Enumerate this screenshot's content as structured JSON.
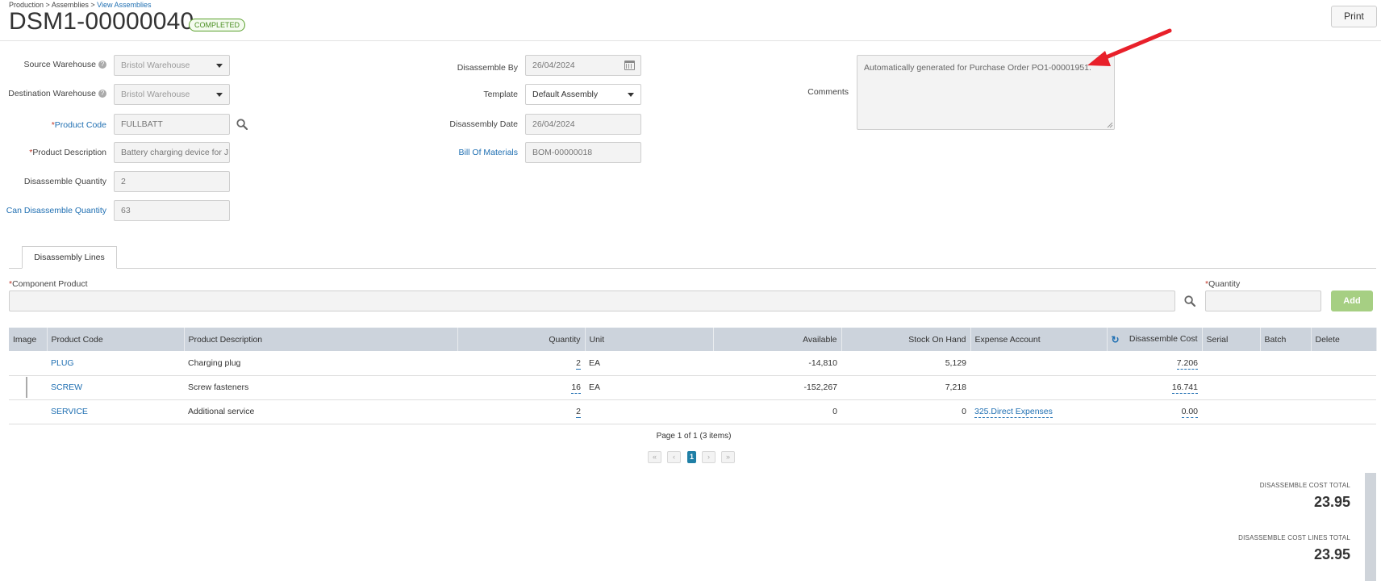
{
  "breadcrumb": {
    "items": [
      "Production",
      "Assemblies",
      "View Assemblies"
    ],
    "separator": ">"
  },
  "header": {
    "title": "DSM1-00000040",
    "status": "COMPLETED",
    "print_label": "Print"
  },
  "form": {
    "source_warehouse": {
      "label": "Source Warehouse",
      "value": "Bristol Warehouse"
    },
    "destination_warehouse": {
      "label": "Destination Warehouse",
      "value": "Bristol Warehouse"
    },
    "product_code": {
      "required": "*",
      "label": "Product Code",
      "value": "FULLBATT"
    },
    "product_description": {
      "required": "*",
      "label": "Product Description",
      "value": "Battery charging device for J"
    },
    "disassemble_quantity": {
      "label": "Disassemble Quantity",
      "value": "2"
    },
    "can_disassemble_quantity": {
      "label": "Can Disassemble Quantity",
      "value": "63"
    },
    "disassemble_by": {
      "label": "Disassemble By",
      "value": "26/04/2024"
    },
    "template": {
      "label": "Template",
      "value": "Default Assembly"
    },
    "disassembly_date": {
      "label": "Disassembly Date",
      "value": "26/04/2024"
    },
    "bill_of_materials": {
      "label": "Bill Of Materials",
      "value": "BOM-00000018"
    },
    "comments": {
      "label": "Comments",
      "value": "Automatically generated for Purchase Order PO1-00001951."
    }
  },
  "tabs": [
    {
      "label": "Disassembly Lines",
      "active": true
    }
  ],
  "add_line": {
    "component_required": "*",
    "component_label": "Component Product",
    "quantity_required": "*",
    "quantity_label": "Quantity",
    "add_label": "Add"
  },
  "table": {
    "columns": [
      "Image",
      "Product Code",
      "Product Description",
      "Quantity",
      "Unit",
      "Available",
      "Stock On Hand",
      "Expense Account",
      "Disassemble Cost",
      "Serial",
      "Batch",
      "Delete"
    ],
    "rows": [
      {
        "code": "PLUG",
        "description": "Charging plug",
        "quantity": "2",
        "unit": "EA",
        "available": "-14,810",
        "stock_on_hand": "5,129",
        "expense_account": "",
        "cost": "7.206"
      },
      {
        "code": "SCREW",
        "description": "Screw fasteners",
        "quantity": "16",
        "unit": "EA",
        "available": "-152,267",
        "stock_on_hand": "7,218",
        "expense_account": "",
        "cost": "16.741"
      },
      {
        "code": "SERVICE",
        "description": "Additional service",
        "quantity": "2",
        "unit": "",
        "available": "0",
        "stock_on_hand": "0",
        "expense_account": "325.Direct Expenses",
        "cost": "0.00"
      }
    ]
  },
  "pagination": {
    "info": "Page 1 of 1 (3 items)",
    "current_page": "1",
    "first": "«",
    "prev": "‹",
    "next": "›",
    "last": "»"
  },
  "totals": {
    "cost_total_label": "DISASSEMBLE COST TOTAL",
    "cost_total_value": "23.95",
    "cost_lines_total_label": "DISASSEMBLE COST LINES TOTAL",
    "cost_lines_total_value": "23.95"
  },
  "colors": {
    "link": "#1f6fb2",
    "status_green": "#5aa02c",
    "add_button": "#a6cf83",
    "table_header": "#ccd3dc",
    "annotation_arrow": "#e8202a"
  },
  "icons": [
    "search-icon",
    "calendar-icon",
    "chevron-down-icon",
    "help-icon",
    "refresh-icon",
    "annotation-arrow"
  ]
}
